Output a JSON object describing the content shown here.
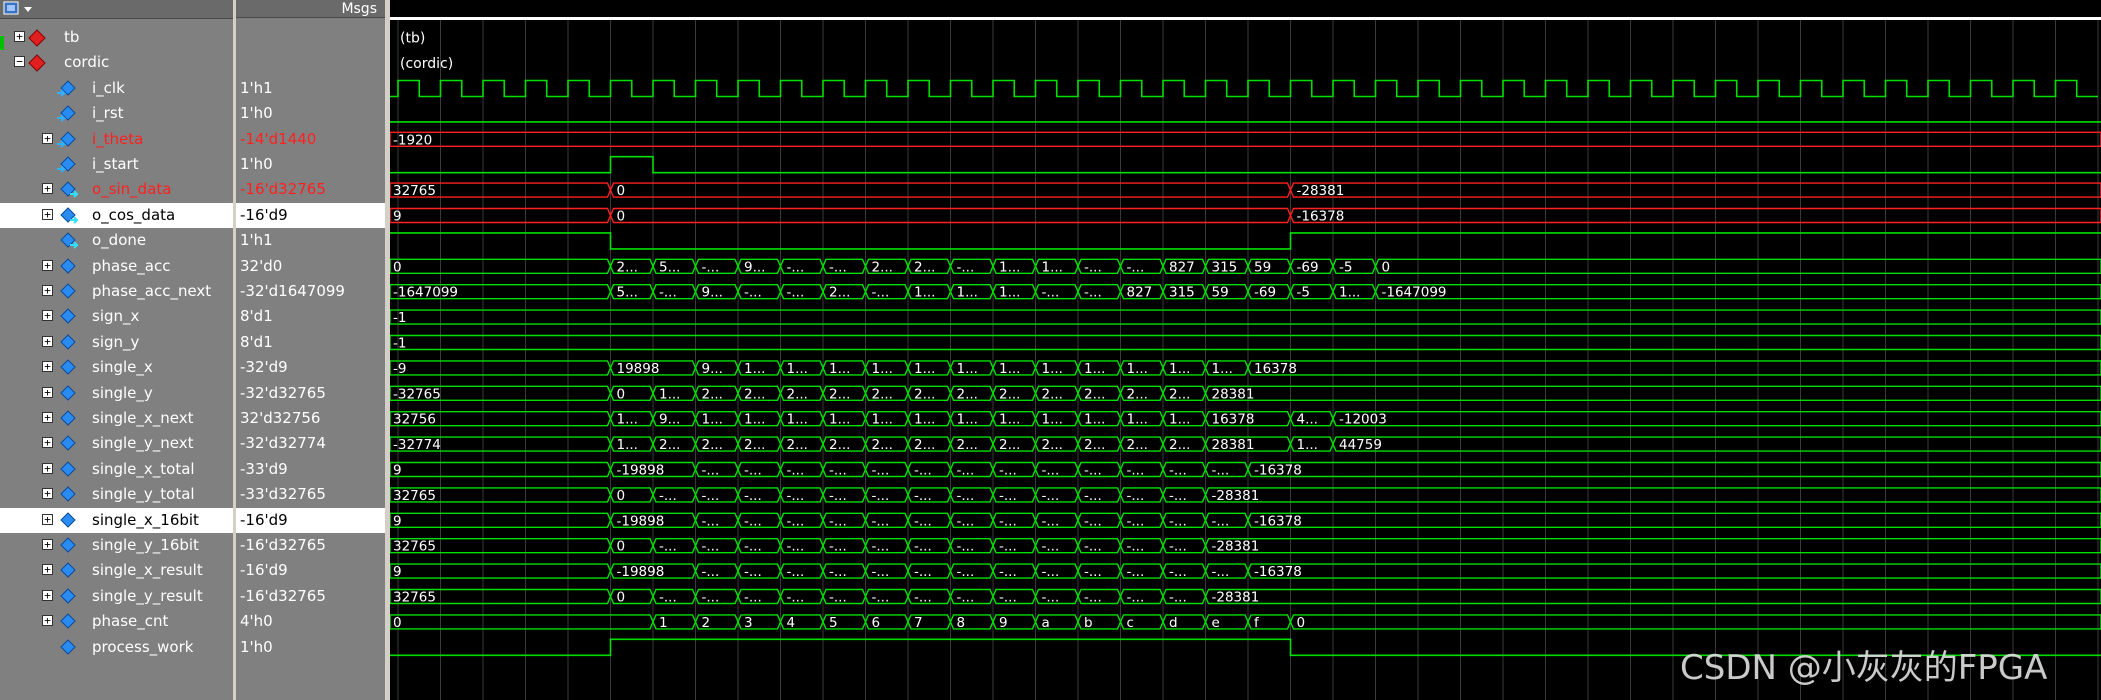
{
  "header": {
    "msgs_label": "Msgs"
  },
  "signals": [
    {
      "name": "tb",
      "value": "",
      "level": 0,
      "expand": "+",
      "icon": "instance",
      "color": "white",
      "selected": false
    },
    {
      "name": "cordic",
      "value": "",
      "level": 0,
      "expand": "-",
      "icon": "instance",
      "color": "white",
      "selected": false
    },
    {
      "name": "i_clk",
      "value": "1'h1",
      "level": 1,
      "expand": "",
      "icon": "input",
      "color": "white",
      "selected": false
    },
    {
      "name": "i_rst",
      "value": "1'h0",
      "level": 1,
      "expand": "",
      "icon": "input",
      "color": "white",
      "selected": false
    },
    {
      "name": "i_theta",
      "value": "-14'd1440",
      "level": 1,
      "expand": "+",
      "icon": "input",
      "color": "red",
      "selected": false
    },
    {
      "name": "i_start",
      "value": "1'h0",
      "level": 1,
      "expand": "",
      "icon": "input",
      "color": "white",
      "selected": false
    },
    {
      "name": "o_sin_data",
      "value": "-16'd32765",
      "level": 1,
      "expand": "+",
      "icon": "output",
      "color": "red",
      "selected": false
    },
    {
      "name": "o_cos_data",
      "value": "-16'd9",
      "level": 1,
      "expand": "+",
      "icon": "output",
      "color": "white",
      "selected": true
    },
    {
      "name": "o_done",
      "value": "1'h1",
      "level": 1,
      "expand": "",
      "icon": "output",
      "color": "white",
      "selected": false
    },
    {
      "name": "phase_acc",
      "value": "32'd0",
      "level": 1,
      "expand": "+",
      "icon": "internal",
      "color": "white",
      "selected": false
    },
    {
      "name": "phase_acc_next",
      "value": "-32'd1647099",
      "level": 1,
      "expand": "+",
      "icon": "internal",
      "color": "white",
      "selected": false
    },
    {
      "name": "sign_x",
      "value": "8'd1",
      "level": 1,
      "expand": "+",
      "icon": "internal",
      "color": "white",
      "selected": false
    },
    {
      "name": "sign_y",
      "value": "8'd1",
      "level": 1,
      "expand": "+",
      "icon": "internal",
      "color": "white",
      "selected": false
    },
    {
      "name": "single_x",
      "value": "-32'd9",
      "level": 1,
      "expand": "+",
      "icon": "internal",
      "color": "white",
      "selected": false
    },
    {
      "name": "single_y",
      "value": "-32'd32765",
      "level": 1,
      "expand": "+",
      "icon": "internal",
      "color": "white",
      "selected": false
    },
    {
      "name": "single_x_next",
      "value": "32'd32756",
      "level": 1,
      "expand": "+",
      "icon": "internal",
      "color": "white",
      "selected": false
    },
    {
      "name": "single_y_next",
      "value": "-32'd32774",
      "level": 1,
      "expand": "+",
      "icon": "internal",
      "color": "white",
      "selected": false
    },
    {
      "name": "single_x_total",
      "value": "-33'd9",
      "level": 1,
      "expand": "+",
      "icon": "internal",
      "color": "white",
      "selected": false
    },
    {
      "name": "single_y_total",
      "value": "-33'd32765",
      "level": 1,
      "expand": "+",
      "icon": "internal",
      "color": "white",
      "selected": false
    },
    {
      "name": "single_x_16bit",
      "value": "-16'd9",
      "level": 1,
      "expand": "+",
      "icon": "internal",
      "color": "white",
      "selected": true
    },
    {
      "name": "single_y_16bit",
      "value": "-16'd32765",
      "level": 1,
      "expand": "+",
      "icon": "internal",
      "color": "white",
      "selected": false
    },
    {
      "name": "single_x_result",
      "value": "-16'd9",
      "level": 1,
      "expand": "+",
      "icon": "internal",
      "color": "white",
      "selected": false
    },
    {
      "name": "single_y_result",
      "value": "-16'd32765",
      "level": 1,
      "expand": "+",
      "icon": "internal",
      "color": "white",
      "selected": false
    },
    {
      "name": "phase_cnt",
      "value": "4'h0",
      "level": 1,
      "expand": "+",
      "icon": "internal",
      "color": "white",
      "selected": false
    },
    {
      "name": "process_work",
      "value": "1'h0",
      "level": 1,
      "expand": "",
      "icon": "internal",
      "color": "white",
      "selected": false
    }
  ],
  "waves": [
    {
      "kind": "label",
      "text": "(tb)"
    },
    {
      "kind": "label",
      "text": "(cordic)"
    },
    {
      "kind": "clock"
    },
    {
      "kind": "bit",
      "init": 0,
      "edges": []
    },
    {
      "kind": "bus",
      "color": "red",
      "init": "-1920",
      "changes": []
    },
    {
      "kind": "bit",
      "init": 0,
      "edges": [
        [
          5,
          1
        ],
        [
          6,
          0
        ]
      ]
    },
    {
      "kind": "bus",
      "color": "red",
      "init": "32765",
      "changes": [
        [
          5,
          "0"
        ],
        [
          21,
          "-28381"
        ]
      ]
    },
    {
      "kind": "bus",
      "color": "red",
      "init": "9",
      "changes": [
        [
          5,
          "0"
        ],
        [
          21,
          "-16378"
        ]
      ]
    },
    {
      "kind": "bit",
      "init": 1,
      "edges": [
        [
          5,
          0
        ],
        [
          21,
          1
        ]
      ]
    },
    {
      "kind": "bus",
      "color": "green",
      "init": "0",
      "changes": [
        [
          5,
          "2..."
        ],
        [
          6,
          "5..."
        ],
        [
          7,
          "-..."
        ],
        [
          8,
          "9..."
        ],
        [
          9,
          "-..."
        ],
        [
          10,
          "-..."
        ],
        [
          11,
          "2..."
        ],
        [
          12,
          "2..."
        ],
        [
          13,
          "-..."
        ],
        [
          14,
          "1..."
        ],
        [
          15,
          "1..."
        ],
        [
          16,
          "-..."
        ],
        [
          17,
          "-..."
        ],
        [
          18,
          "827"
        ],
        [
          19,
          "315"
        ],
        [
          20,
          "59"
        ],
        [
          21,
          "-69"
        ],
        [
          22,
          "-5"
        ],
        [
          23,
          "0"
        ]
      ]
    },
    {
      "kind": "bus",
      "color": "green",
      "init": "-1647099",
      "changes": [
        [
          5,
          "5..."
        ],
        [
          6,
          "-..."
        ],
        [
          7,
          "9..."
        ],
        [
          8,
          "-..."
        ],
        [
          9,
          "-..."
        ],
        [
          10,
          "2..."
        ],
        [
          11,
          "-..."
        ],
        [
          12,
          "1..."
        ],
        [
          13,
          "1..."
        ],
        [
          14,
          "1..."
        ],
        [
          15,
          "-..."
        ],
        [
          16,
          "-..."
        ],
        [
          17,
          "827"
        ],
        [
          18,
          "315"
        ],
        [
          19,
          "59"
        ],
        [
          20,
          "-69"
        ],
        [
          21,
          "-5"
        ],
        [
          22,
          "1..."
        ],
        [
          23,
          "-1647099"
        ]
      ]
    },
    {
      "kind": "bus",
      "color": "green",
      "init": "-1",
      "changes": []
    },
    {
      "kind": "bus",
      "color": "green",
      "init": "-1",
      "changes": []
    },
    {
      "kind": "bus",
      "color": "green",
      "init": "-9",
      "changes": [
        [
          5,
          "19898"
        ],
        [
          7,
          "9..."
        ],
        [
          8,
          "1..."
        ],
        [
          9,
          "1..."
        ],
        [
          10,
          "1..."
        ],
        [
          11,
          "1..."
        ],
        [
          12,
          "1..."
        ],
        [
          13,
          "1..."
        ],
        [
          14,
          "1..."
        ],
        [
          15,
          "1..."
        ],
        [
          16,
          "1..."
        ],
        [
          17,
          "1..."
        ],
        [
          18,
          "1..."
        ],
        [
          19,
          "1..."
        ],
        [
          20,
          "16378"
        ]
      ]
    },
    {
      "kind": "bus",
      "color": "green",
      "init": "-32765",
      "changes": [
        [
          5,
          "0"
        ],
        [
          6,
          "1..."
        ],
        [
          7,
          "2..."
        ],
        [
          8,
          "2..."
        ],
        [
          9,
          "2..."
        ],
        [
          10,
          "2..."
        ],
        [
          11,
          "2..."
        ],
        [
          12,
          "2..."
        ],
        [
          13,
          "2..."
        ],
        [
          14,
          "2..."
        ],
        [
          15,
          "2..."
        ],
        [
          16,
          "2..."
        ],
        [
          17,
          "2..."
        ],
        [
          18,
          "2..."
        ],
        [
          19,
          "28381"
        ]
      ]
    },
    {
      "kind": "bus",
      "color": "green",
      "init": "32756",
      "changes": [
        [
          5,
          "1..."
        ],
        [
          6,
          "9..."
        ],
        [
          7,
          "1..."
        ],
        [
          8,
          "1..."
        ],
        [
          9,
          "1..."
        ],
        [
          10,
          "1..."
        ],
        [
          11,
          "1..."
        ],
        [
          12,
          "1..."
        ],
        [
          13,
          "1..."
        ],
        [
          14,
          "1..."
        ],
        [
          15,
          "1..."
        ],
        [
          16,
          "1..."
        ],
        [
          17,
          "1..."
        ],
        [
          18,
          "1..."
        ],
        [
          19,
          "16378"
        ],
        [
          21,
          "4..."
        ],
        [
          22,
          "-12003"
        ]
      ]
    },
    {
      "kind": "bus",
      "color": "green",
      "init": "-32774",
      "changes": [
        [
          5,
          "1..."
        ],
        [
          6,
          "2..."
        ],
        [
          7,
          "2..."
        ],
        [
          8,
          "2..."
        ],
        [
          9,
          "2..."
        ],
        [
          10,
          "2..."
        ],
        [
          11,
          "2..."
        ],
        [
          12,
          "2..."
        ],
        [
          13,
          "2..."
        ],
        [
          14,
          "2..."
        ],
        [
          15,
          "2..."
        ],
        [
          16,
          "2..."
        ],
        [
          17,
          "2..."
        ],
        [
          18,
          "2..."
        ],
        [
          19,
          "28381"
        ],
        [
          21,
          "1..."
        ],
        [
          22,
          "44759"
        ]
      ]
    },
    {
      "kind": "bus",
      "color": "green",
      "init": "9",
      "changes": [
        [
          5,
          "-19898"
        ],
        [
          7,
          "-..."
        ],
        [
          8,
          "-..."
        ],
        [
          9,
          "-..."
        ],
        [
          10,
          "-..."
        ],
        [
          11,
          "-..."
        ],
        [
          12,
          "-..."
        ],
        [
          13,
          "-..."
        ],
        [
          14,
          "-..."
        ],
        [
          15,
          "-..."
        ],
        [
          16,
          "-..."
        ],
        [
          17,
          "-..."
        ],
        [
          18,
          "-..."
        ],
        [
          19,
          "-..."
        ],
        [
          20,
          "-16378"
        ]
      ]
    },
    {
      "kind": "bus",
      "color": "green",
      "init": "32765",
      "changes": [
        [
          5,
          "0"
        ],
        [
          6,
          "-..."
        ],
        [
          7,
          "-..."
        ],
        [
          8,
          "-..."
        ],
        [
          9,
          "-..."
        ],
        [
          10,
          "-..."
        ],
        [
          11,
          "-..."
        ],
        [
          12,
          "-..."
        ],
        [
          13,
          "-..."
        ],
        [
          14,
          "-..."
        ],
        [
          15,
          "-..."
        ],
        [
          16,
          "-..."
        ],
        [
          17,
          "-..."
        ],
        [
          18,
          "-..."
        ],
        [
          19,
          "-28381"
        ]
      ]
    },
    {
      "kind": "bus",
      "color": "green",
      "init": "9",
      "changes": [
        [
          5,
          "-19898"
        ],
        [
          7,
          "-..."
        ],
        [
          8,
          "-..."
        ],
        [
          9,
          "-..."
        ],
        [
          10,
          "-..."
        ],
        [
          11,
          "-..."
        ],
        [
          12,
          "-..."
        ],
        [
          13,
          "-..."
        ],
        [
          14,
          "-..."
        ],
        [
          15,
          "-..."
        ],
        [
          16,
          "-..."
        ],
        [
          17,
          "-..."
        ],
        [
          18,
          "-..."
        ],
        [
          19,
          "-..."
        ],
        [
          20,
          "-16378"
        ]
      ]
    },
    {
      "kind": "bus",
      "color": "green",
      "init": "32765",
      "changes": [
        [
          5,
          "0"
        ],
        [
          6,
          "-..."
        ],
        [
          7,
          "-..."
        ],
        [
          8,
          "-..."
        ],
        [
          9,
          "-..."
        ],
        [
          10,
          "-..."
        ],
        [
          11,
          "-..."
        ],
        [
          12,
          "-..."
        ],
        [
          13,
          "-..."
        ],
        [
          14,
          "-..."
        ],
        [
          15,
          "-..."
        ],
        [
          16,
          "-..."
        ],
        [
          17,
          "-..."
        ],
        [
          18,
          "-..."
        ],
        [
          19,
          "-28381"
        ]
      ]
    },
    {
      "kind": "bus",
      "color": "green",
      "init": "9",
      "changes": [
        [
          5,
          "-19898"
        ],
        [
          7,
          "-..."
        ],
        [
          8,
          "-..."
        ],
        [
          9,
          "-..."
        ],
        [
          10,
          "-..."
        ],
        [
          11,
          "-..."
        ],
        [
          12,
          "-..."
        ],
        [
          13,
          "-..."
        ],
        [
          14,
          "-..."
        ],
        [
          15,
          "-..."
        ],
        [
          16,
          "-..."
        ],
        [
          17,
          "-..."
        ],
        [
          18,
          "-..."
        ],
        [
          19,
          "-..."
        ],
        [
          20,
          "-16378"
        ]
      ]
    },
    {
      "kind": "bus",
      "color": "green",
      "init": "32765",
      "changes": [
        [
          5,
          "0"
        ],
        [
          6,
          "-..."
        ],
        [
          7,
          "-..."
        ],
        [
          8,
          "-..."
        ],
        [
          9,
          "-..."
        ],
        [
          10,
          "-..."
        ],
        [
          11,
          "-..."
        ],
        [
          12,
          "-..."
        ],
        [
          13,
          "-..."
        ],
        [
          14,
          "-..."
        ],
        [
          15,
          "-..."
        ],
        [
          16,
          "-..."
        ],
        [
          17,
          "-..."
        ],
        [
          18,
          "-..."
        ],
        [
          19,
          "-28381"
        ]
      ]
    },
    {
      "kind": "bus",
      "color": "green",
      "init": "0",
      "changes": [
        [
          6,
          "1"
        ],
        [
          7,
          "2"
        ],
        [
          8,
          "3"
        ],
        [
          9,
          "4"
        ],
        [
          10,
          "5"
        ],
        [
          11,
          "6"
        ],
        [
          12,
          "7"
        ],
        [
          13,
          "8"
        ],
        [
          14,
          "9"
        ],
        [
          15,
          "a"
        ],
        [
          16,
          "b"
        ],
        [
          17,
          "c"
        ],
        [
          18,
          "d"
        ],
        [
          19,
          "e"
        ],
        [
          20,
          "f"
        ],
        [
          21,
          "0"
        ]
      ]
    },
    {
      "kind": "bit",
      "init": 0,
      "edges": [
        [
          5,
          1
        ],
        [
          21,
          0
        ]
      ]
    }
  ],
  "clock_cycles": 40,
  "watermark": "CSDN @小灰灰的FPGA",
  "colors": {
    "wave": "#00e000",
    "red_bus": "#ff2020",
    "grid": "#3a3a3a",
    "pane": "#808080",
    "selected": "#ffffff"
  }
}
